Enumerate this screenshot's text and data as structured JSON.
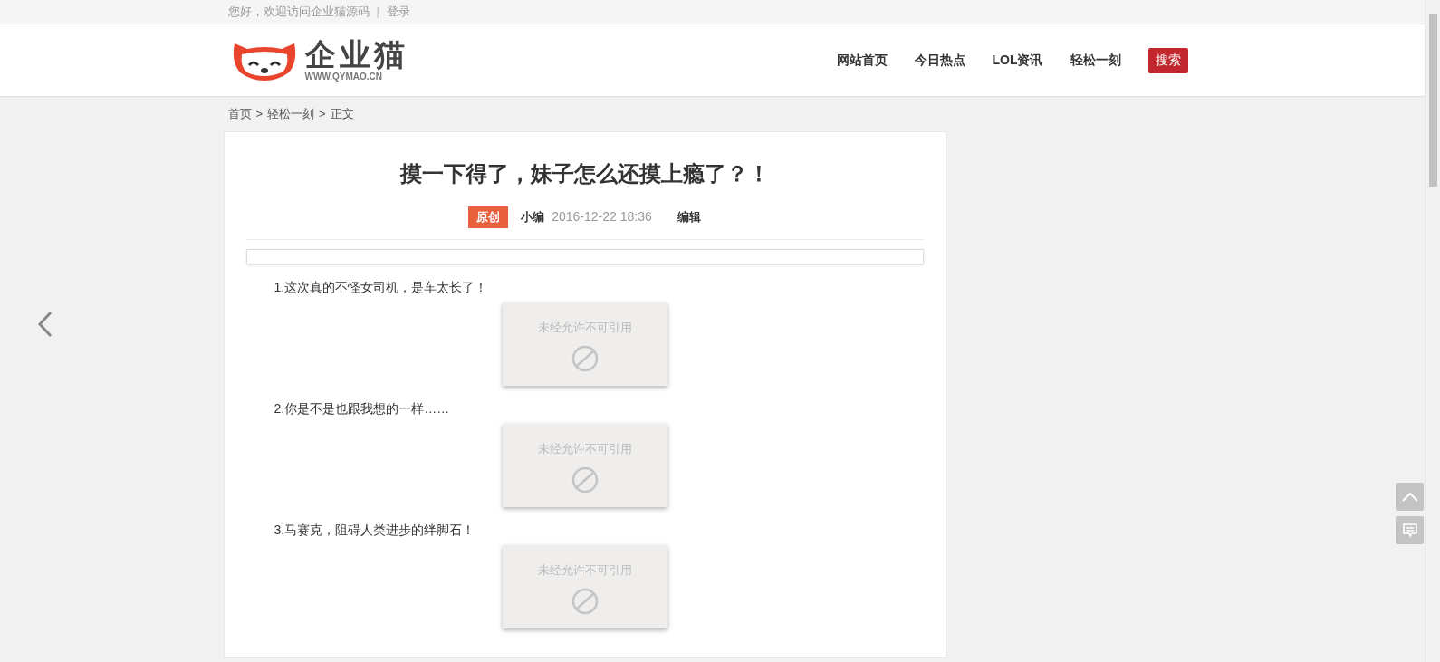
{
  "topbar": {
    "greeting": "您好，欢迎访问企业猫源码",
    "separator": "|",
    "login": "登录"
  },
  "logo": {
    "name": "企业猫",
    "url": "WWW.QYMAO.CN"
  },
  "nav": [
    {
      "label": "网站首页",
      "kind": "link"
    },
    {
      "label": "今日热点",
      "kind": "link"
    },
    {
      "label": "LOL资讯",
      "kind": "link"
    },
    {
      "label": "轻松一刻",
      "kind": "link"
    },
    {
      "label": "搜索",
      "kind": "button"
    }
  ],
  "breadcrumb": [
    {
      "label": "首页"
    },
    {
      "label": "轻松一刻"
    },
    {
      "label": "正文"
    }
  ],
  "breadcrumb_separator": ">",
  "article": {
    "title": "摸一下得了，妹子怎么还摸上瘾了？！",
    "tag": "原创",
    "author": "小编",
    "date": "2016-12-22 18:36",
    "edit": "编辑",
    "items": [
      {
        "caption": "1.这次真的不怪女司机，是车太长了！",
        "image_notice": "未经允许不可引用"
      },
      {
        "caption": "2.你是不是也跟我想的一样……",
        "image_notice": "未经允许不可引用"
      },
      {
        "caption": "3.马赛克，阻碍人类进步的绊脚石！",
        "image_notice": "未经允许不可引用"
      }
    ]
  }
}
